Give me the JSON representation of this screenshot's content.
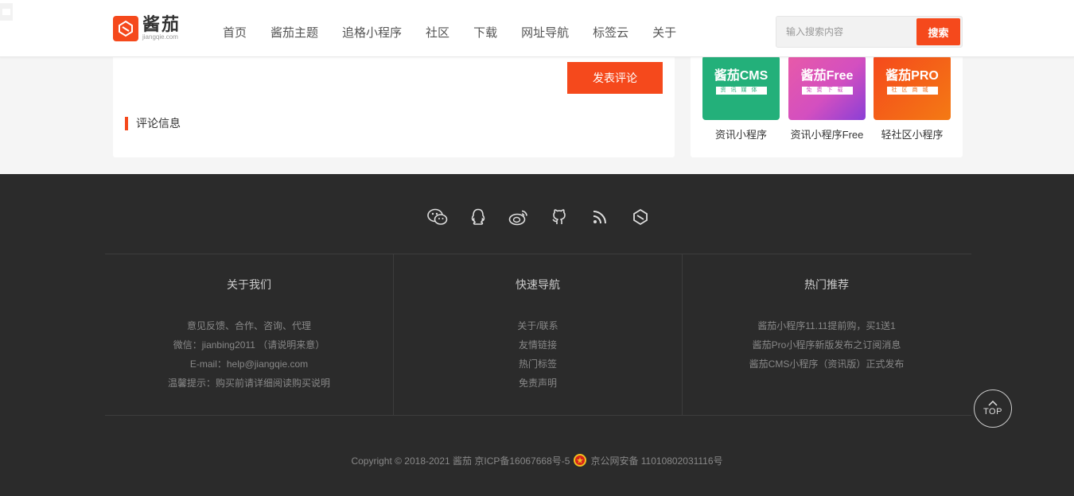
{
  "header": {
    "logo": {
      "cn": "酱茄",
      "en": "jiangqie.com"
    },
    "nav": [
      "首页",
      "酱茄主题",
      "追格小程序",
      "社区",
      "下载",
      "网址导航",
      "标签云",
      "关于"
    ],
    "search": {
      "placeholder": "输入搜索内容",
      "button": "搜索"
    }
  },
  "comment": {
    "submit_label": "发表评论",
    "section_title": "评论信息"
  },
  "apps": [
    {
      "image_title": "酱茄CMS",
      "image_sub": "资讯媒体",
      "label": "资讯小程序",
      "color": "#23b07a"
    },
    {
      "image_title": "酱茄Free",
      "image_sub": "免费下载",
      "label": "资讯小程序Free",
      "color": "#d34fc0"
    },
    {
      "image_title": "酱茄PRO",
      "image_sub": "社区商城",
      "label": "轻社区小程序",
      "color": "#f26a14"
    }
  ],
  "footer": {
    "social_icons": [
      "wechat-icon",
      "qq-icon",
      "weibo-icon",
      "github-icon",
      "rss-icon",
      "jiangqie-icon"
    ],
    "columns": [
      {
        "title": "关于我们",
        "lines": [
          "意见反馈、合作、咨询、代理",
          "微信：jianbing2011 （请说明来意）",
          "E-mail：help@jiangqie.com",
          "温馨提示：购买前请详细阅读购买说明"
        ]
      },
      {
        "title": "快速导航",
        "lines": [
          "关于/联系",
          "友情链接",
          "热门标签",
          "免责声明"
        ]
      },
      {
        "title": "热门推荐",
        "lines": [
          "酱茄小程序11.11提前购，买1送1",
          "酱茄Pro小程序新版发布之订阅消息",
          "酱茄CMS小程序（资讯版）正式发布"
        ]
      }
    ],
    "copyright_left": "Copyright © 2018-2021 酱茄 京ICP备16067668号-5",
    "copyright_right": "京公网安备 11010802031116号",
    "top_label": "TOP"
  },
  "colors": {
    "accent": "#f5491c",
    "footer_bg": "#2b2b2b"
  }
}
